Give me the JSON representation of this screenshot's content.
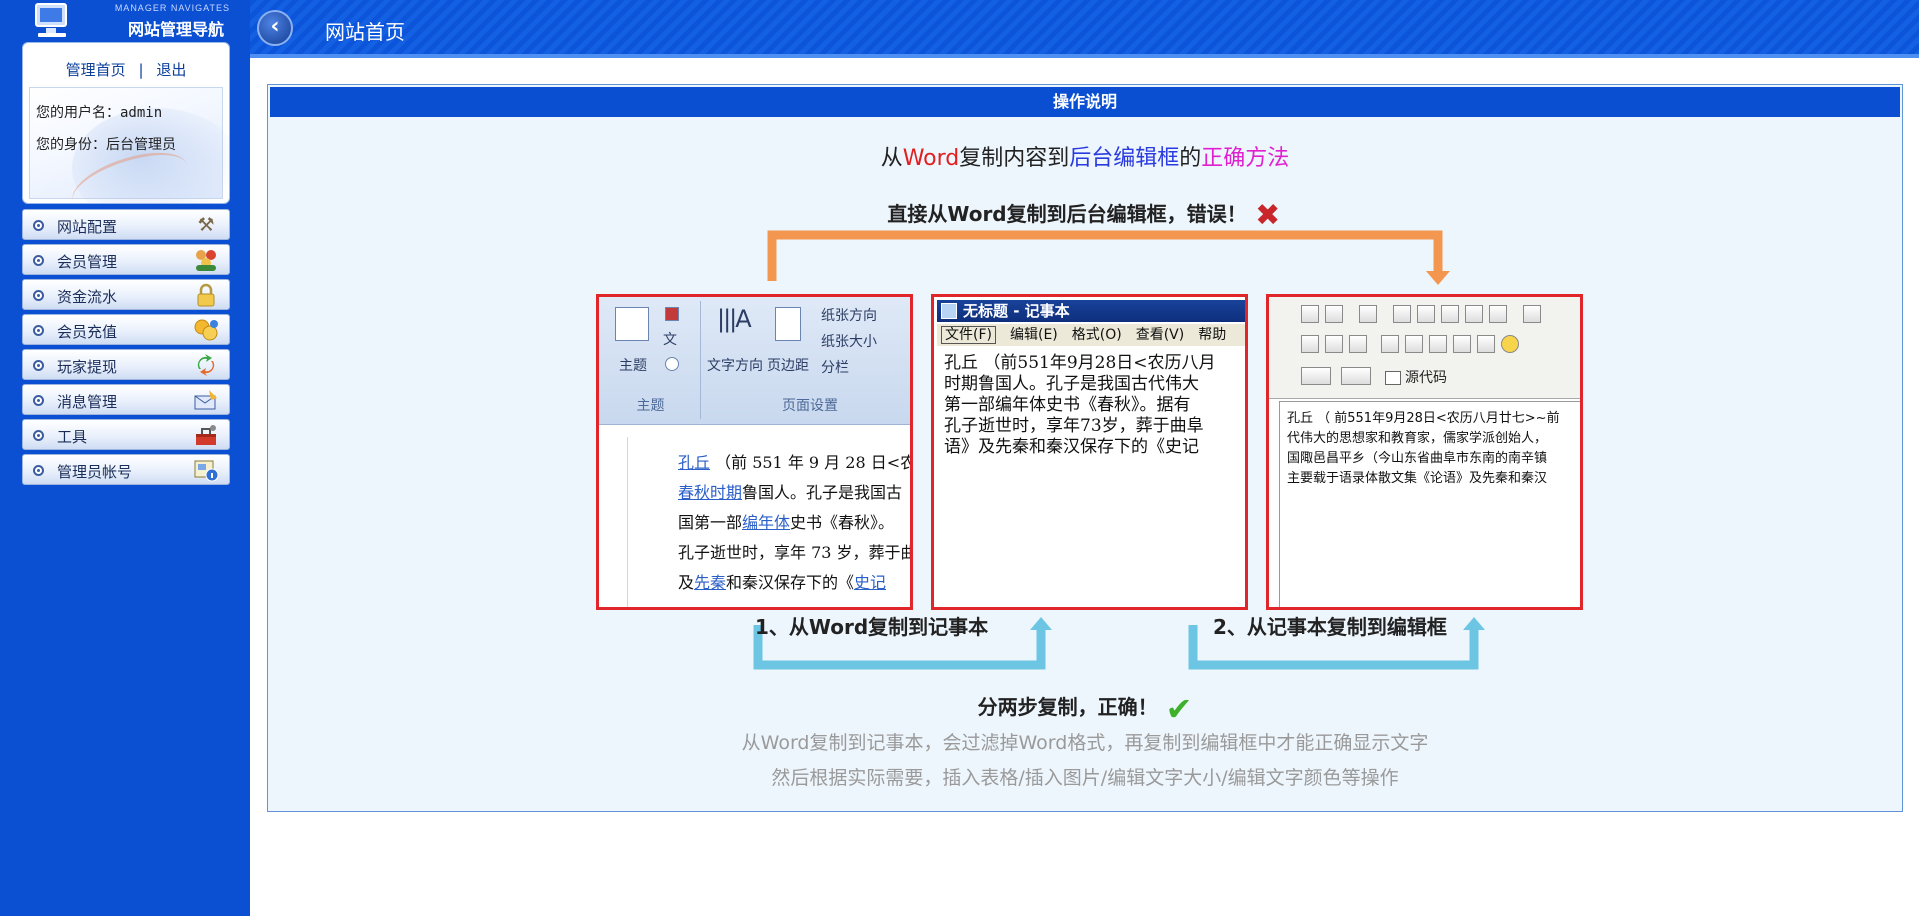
{
  "sidebar": {
    "logo_sub": "MANAGER NAVIGATES",
    "logo_title": "网站管理导航",
    "user_links": {
      "home": "管理首页",
      "separator": "|",
      "logout": "退出"
    },
    "username_label": "您的用户名：",
    "username": "admin",
    "role_label": "您的身份：",
    "role": "后台管理员",
    "menu": [
      {
        "label": "网站配置",
        "icon": "tools-icon"
      },
      {
        "label": "会员管理",
        "icon": "members-icon"
      },
      {
        "label": "资金流水",
        "icon": "lock-icon"
      },
      {
        "label": "会员充值",
        "icon": "coins-icon"
      },
      {
        "label": "玩家提现",
        "icon": "exchange-icon"
      },
      {
        "label": "消息管理",
        "icon": "message-icon"
      },
      {
        "label": "工具",
        "icon": "toolbox-icon"
      },
      {
        "label": "管理员帐号",
        "icon": "admin-card-icon"
      }
    ]
  },
  "header": {
    "title": "网站首页",
    "back_icon": "chevron-left-icon"
  },
  "panel": {
    "heading": "操作说明",
    "title_parts": [
      "从",
      "Word",
      "复制内容到",
      "后台编辑框",
      "的",
      "正确方法"
    ],
    "wrong_text": "直接从Word复制到后台编辑框，错误！",
    "word_ribbon": {
      "theme": "主题",
      "text_dir": "文字方向",
      "margin": "页边距",
      "paper_dir": "纸张方向",
      "paper_size": "纸张大小",
      "columns": "分栏",
      "group_theme": "主题",
      "group_page": "页面设置"
    },
    "word_lines": [
      [
        "孔丘",
        "（前 551 年 9 月 28 日<农"
      ],
      [
        "春秋时期",
        "鲁国人。孔子是我国古"
      ],
      [
        "国第一部",
        "编年体",
        "史书《春秋》。"
      ],
      [
        "孔子逝世时，享年 73 岁，葬于曲"
      ],
      [
        "及",
        "先秦",
        "和秦汉保存下的《",
        "史记"
      ]
    ],
    "notepad": {
      "title": "无标题 - 记事本",
      "menu": [
        "文件(F)",
        "编辑(E)",
        "格式(O)",
        "查看(V)",
        "帮助"
      ],
      "lines": [
        "孔丘 （前551年9月28日<农历八月",
        "时期鲁国人。孔子是我国古代伟大",
        "第一部编年体史书《春秋》。据有",
        "孔子逝世时，享年73岁，葬于曲阜",
        "语》及先秦和秦汉保存下的《史记"
      ]
    },
    "editor": {
      "source_label": "源代码",
      "lines": [
        "孔丘 （ 前551年9月28日<农历八月廿七>~前",
        "代伟大的思想家和教育家，儒家学派创始人，",
        "国陬邑昌平乡（今山东省曲阜市东南的南辛镇",
        "主要载于语录体散文集《论语》及先秦和秦汉"
      ]
    },
    "step1": "1、从Word复制到记事本",
    "step2": "2、从记事本复制到编辑框",
    "right_text": "分两步复制，正确！",
    "note1": "从Word复制到记事本，会过滤掉Word格式，再复制到编辑框中才能正确显示文字",
    "note2": "然后根据实际需要，插入表格/插入图片/编辑文字大小/编辑文字颜色等操作",
    "colors": {
      "wrong_arrow": "#f3964f",
      "right_arrow": "#6cc6e3",
      "frame": "#e0262a",
      "title_red": "#e02020",
      "title_blue": "#2a3ae0",
      "title_pink": "#e020d0"
    }
  }
}
